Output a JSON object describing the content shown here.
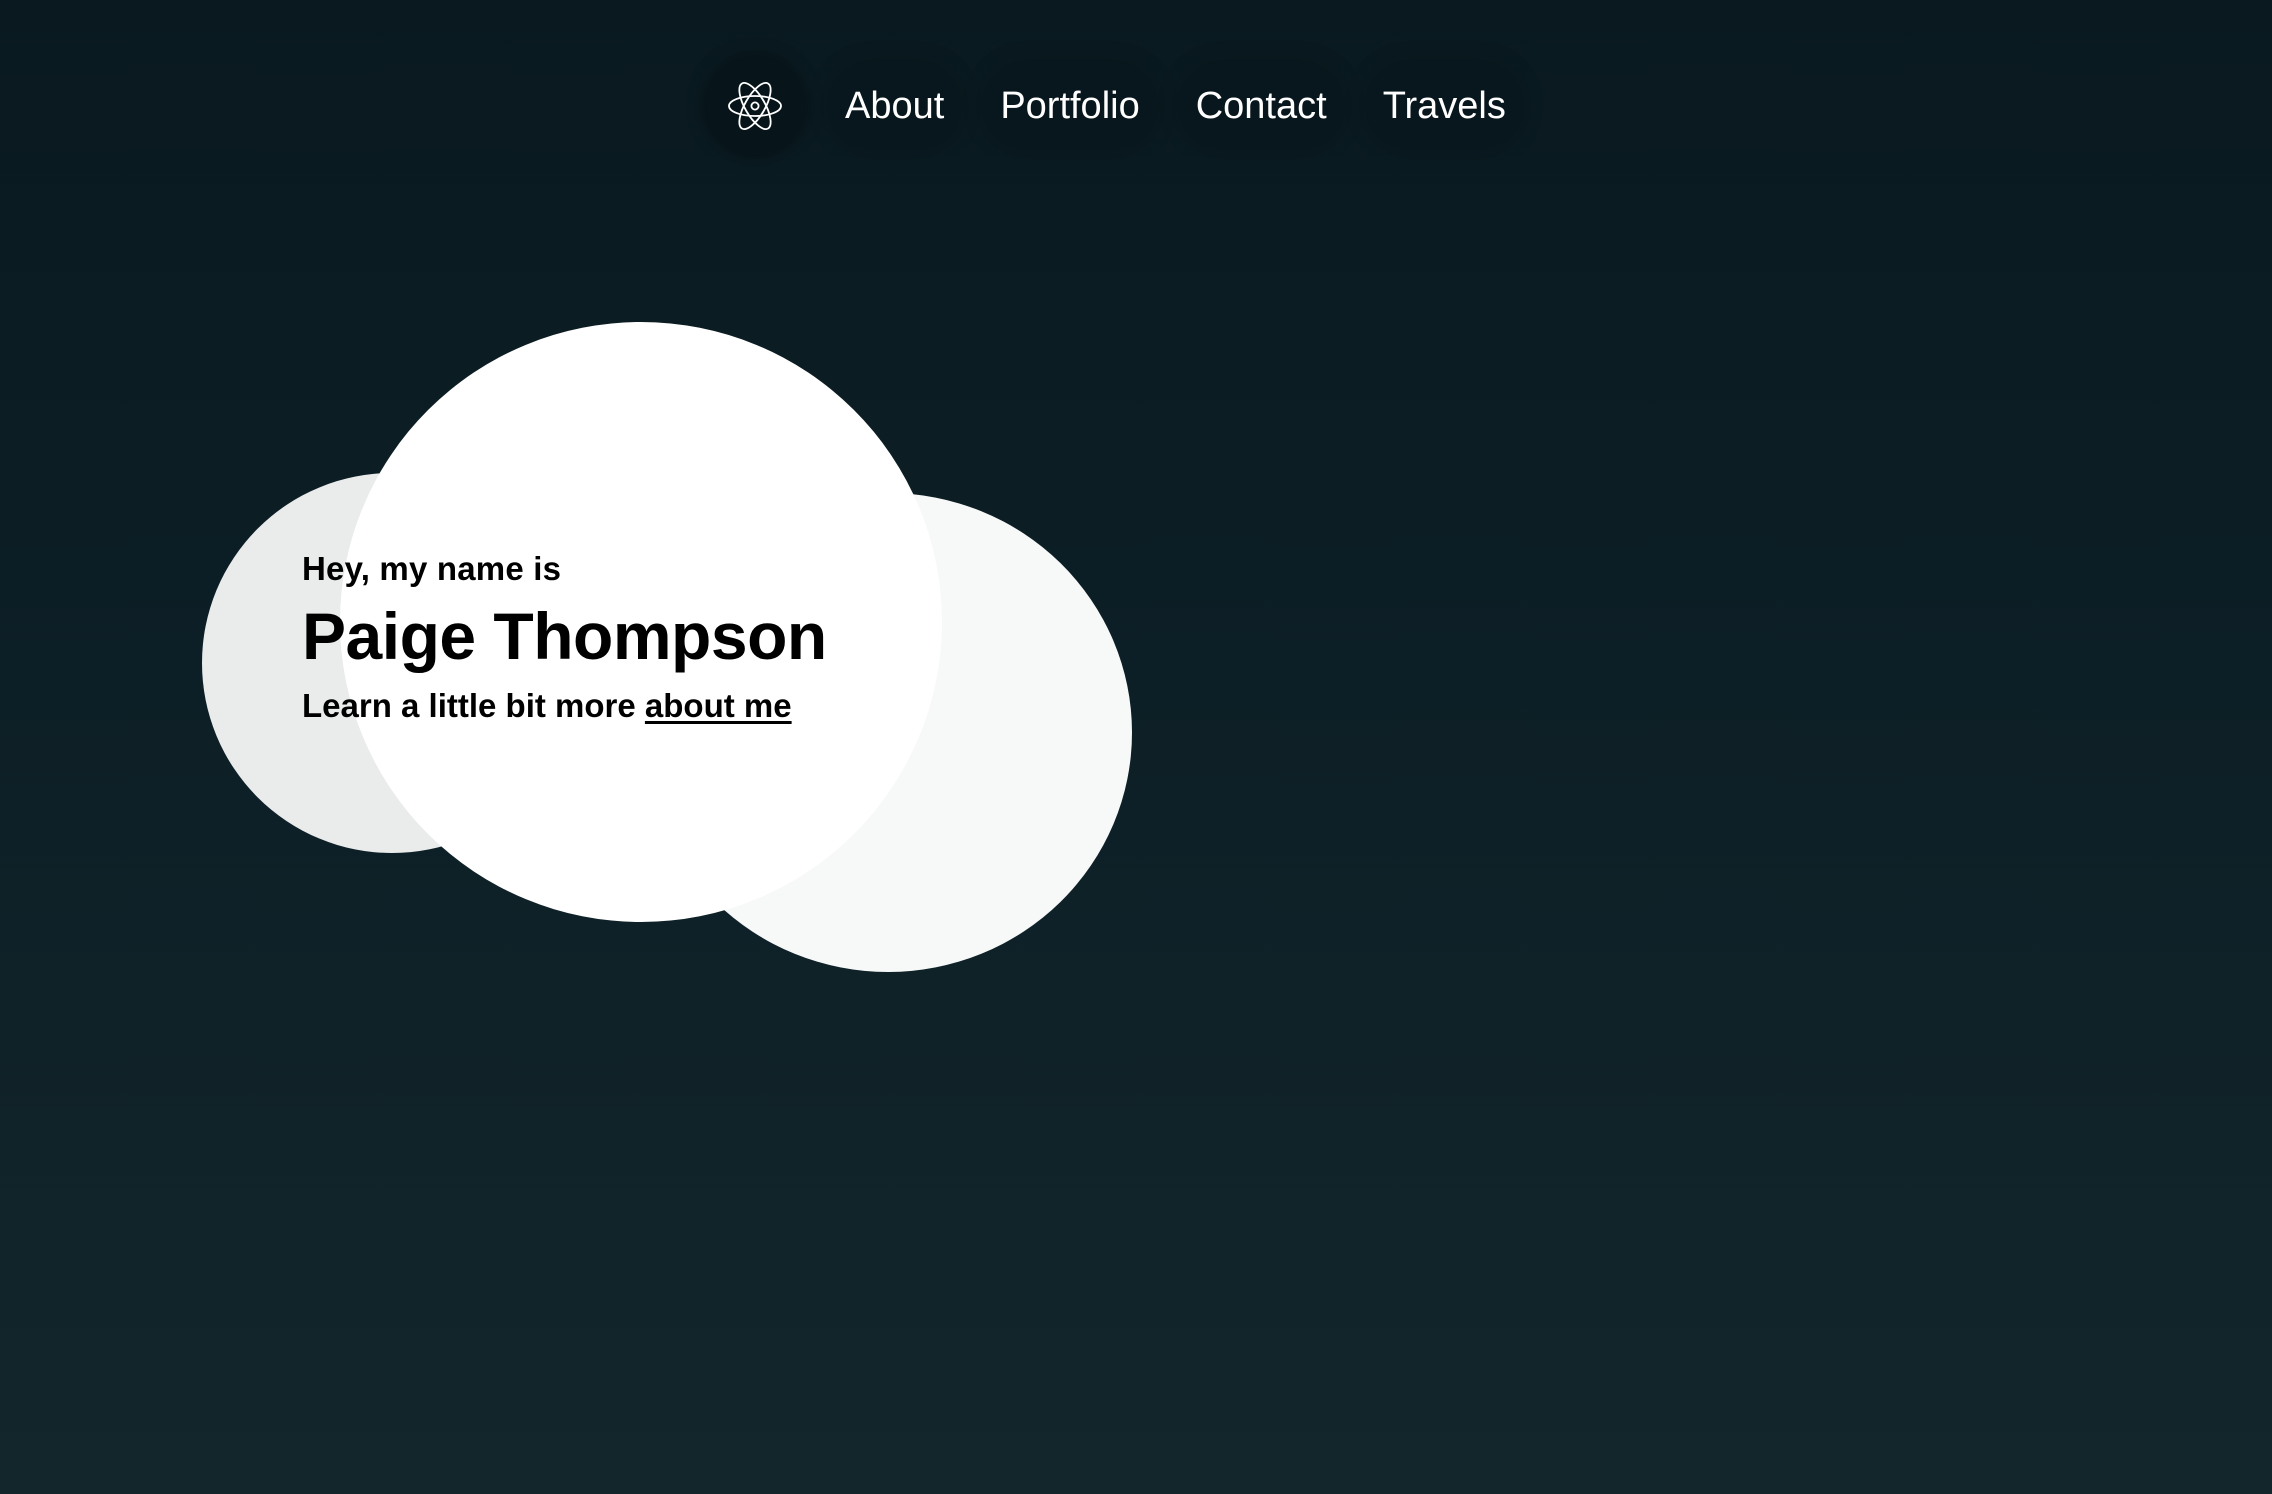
{
  "nav": {
    "logo_icon": "atom-icon",
    "items": [
      {
        "label": "About"
      },
      {
        "label": "Portfolio"
      },
      {
        "label": "Contact"
      },
      {
        "label": "Travels"
      }
    ]
  },
  "hero": {
    "greeting": "Hey, my name is",
    "name": "Paige Thompson",
    "subtitle_prefix": "Learn a little bit more",
    "subtitle_link": "about me"
  },
  "colors": {
    "background_top": "#09191f",
    "background_bottom": "#12262b",
    "nav_text": "#ffffff",
    "hero_text": "#000000",
    "cloud_main": "#ffffff",
    "cloud_left": "#eaecec",
    "cloud_right": "#f7f8f8"
  }
}
